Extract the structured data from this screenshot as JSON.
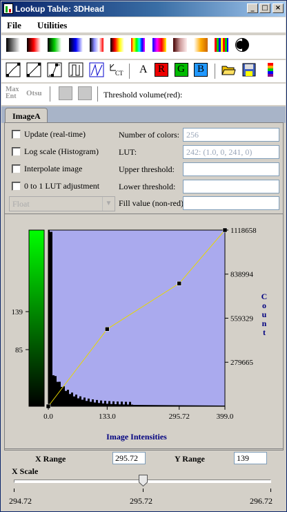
{
  "window": {
    "title": "Lookup Table: 3DHead",
    "min_glyph": "_",
    "max_glyph": "□",
    "close_glyph": "×"
  },
  "menu": {
    "file": "File",
    "utilities": "Utilities"
  },
  "toolbar1": {
    "icons": [
      "gray-lut-icon",
      "red-lut-icon",
      "green-lut-icon",
      "blue-lut-icon",
      "gray-blue-lut-icon",
      "hot-metal-lut-icon",
      "spectrum-lut-icon",
      "cool-hot-lut-icon",
      "bone-lut-icon",
      "orange-lut-icon",
      "stripes-lut-icon",
      "invert-lut-icon"
    ]
  },
  "toolbar2": {
    "text_a": "A",
    "text_r": "R",
    "text_g": "G",
    "text_b": "B",
    "ct": "CT"
  },
  "toolbar3": {
    "max_ent": "Max Ent",
    "otsu": "Otsu",
    "threshold_label": "Threshold volume(red):"
  },
  "tab": {
    "label": "ImageA"
  },
  "options": {
    "update": "Update (real-time)",
    "logscale": "Log scale (Histogram)",
    "interpolate": "Interpolate image",
    "lut01": "0 to 1 LUT adjustment",
    "datatype": "Float"
  },
  "fields": {
    "num_colors_label": "Number of colors:",
    "num_colors": "256",
    "lut_label": "LUT:",
    "lut": "242: (1.0, 0, 241, 0)",
    "upper_label": "Upper threshold:",
    "upper": "",
    "lower_label": "Lower threshold:",
    "lower": "",
    "fill_label": "Fill value (non-red):",
    "fill": ""
  },
  "chart_data": {
    "type": "line",
    "xlabel": "Image Intensities",
    "ylabel_right": "Count",
    "x_ticks": [
      "0.0",
      "133.0",
      "295.72",
      "399.0"
    ],
    "y_right_ticks": [
      "1118658",
      "838994",
      "559329",
      "279665"
    ],
    "y_left_ticks": [
      "139",
      "85"
    ],
    "xlim": [
      0,
      399
    ],
    "ylim": [
      0,
      1118658
    ],
    "transfer_points": [
      {
        "x": 0,
        "y": 0
      },
      {
        "x": 133,
        "y": 490000
      },
      {
        "x": 295.72,
        "y": 780000
      },
      {
        "x": 399,
        "y": 1118658
      }
    ],
    "histogram_note": "sharp spike near zero intensity decaying quickly",
    "colors": {
      "plot_bg": "#aaaaee",
      "curve": "#e8d800",
      "histogram": "#000000"
    }
  },
  "range": {
    "x_label": "X Range",
    "x_value": "295.72",
    "y_label": "Y Range",
    "y_value": "139"
  },
  "scale": {
    "label": "X Scale",
    "min": "294.72",
    "mid": "295.72",
    "max": "296.72",
    "value_fraction": 0.5
  }
}
